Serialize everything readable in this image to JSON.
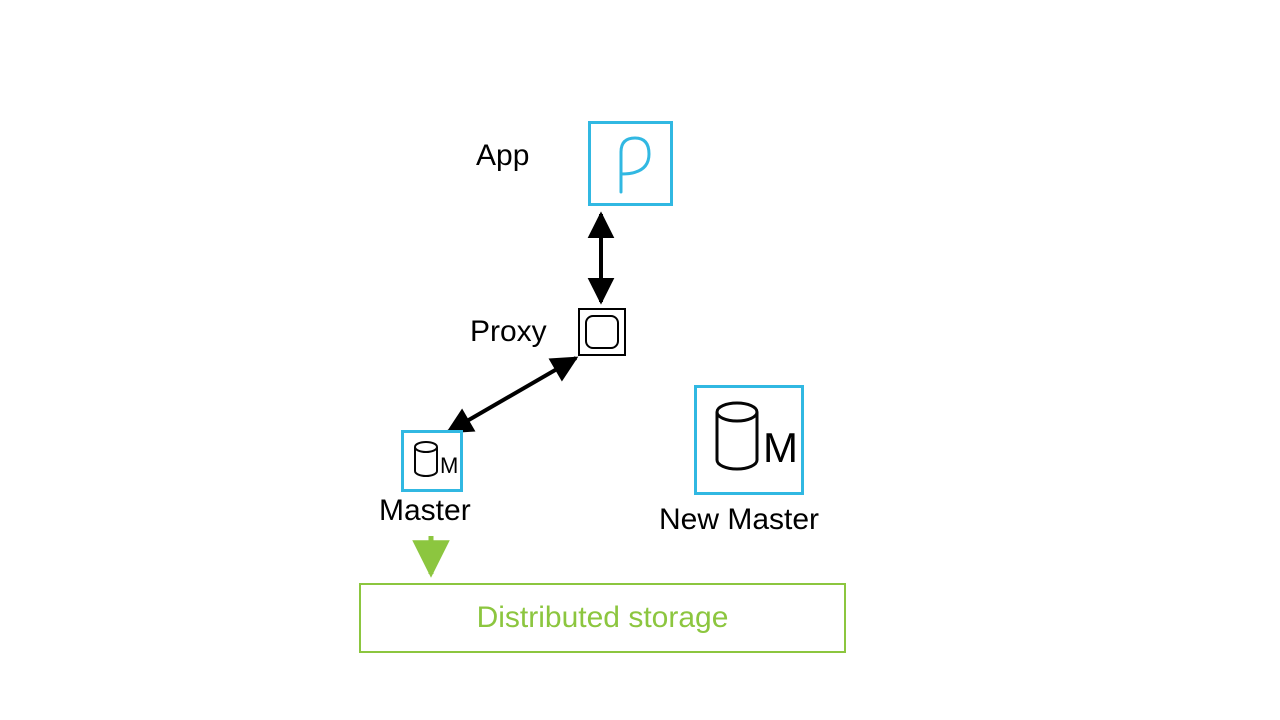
{
  "nodes": {
    "app": {
      "label": "App"
    },
    "proxy": {
      "label": "Proxy"
    },
    "master": {
      "label": "Master",
      "letter": "M"
    },
    "new_master": {
      "label": "New Master",
      "letter": "M"
    },
    "storage": {
      "label": "Distributed storage"
    }
  },
  "colors": {
    "accent": "#31b8e2",
    "green": "#8cc63f",
    "black": "#000000"
  },
  "edges": [
    {
      "from": "app",
      "to": "proxy",
      "bidir": true
    },
    {
      "from": "proxy",
      "to": "master",
      "bidir": true
    },
    {
      "from": "master",
      "to": "storage",
      "bidir": false,
      "color": "green"
    }
  ]
}
